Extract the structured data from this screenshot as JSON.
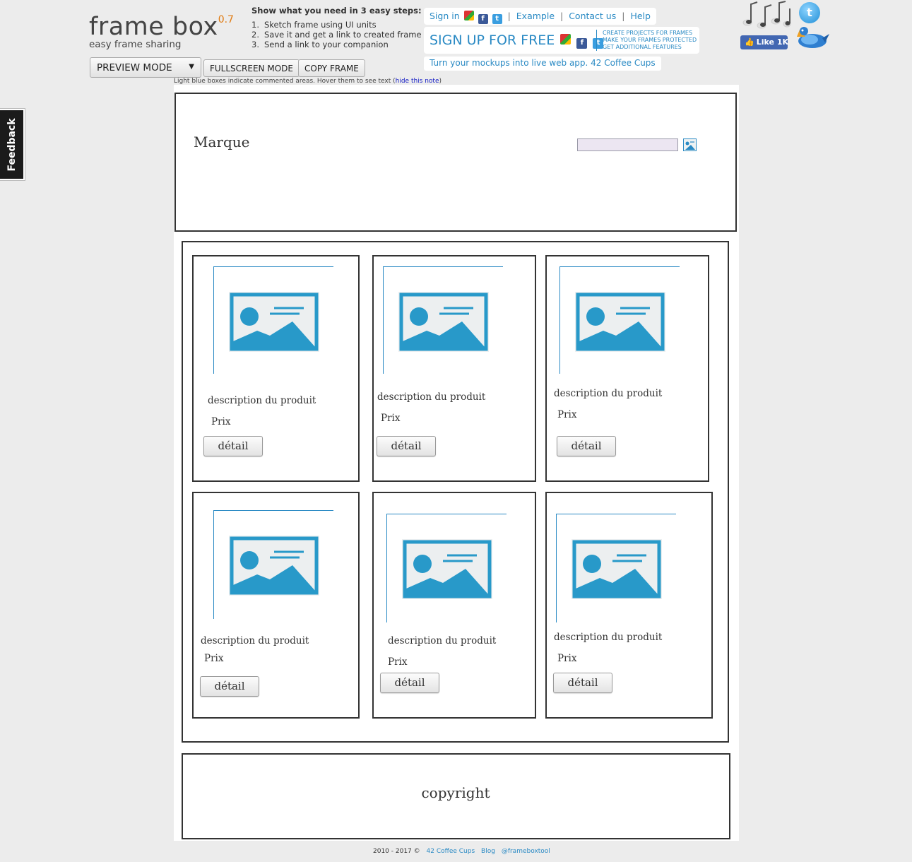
{
  "app": {
    "name": "frame box",
    "version": "0.7",
    "tagline": "easy frame sharing"
  },
  "steps": {
    "title": "Show what you need in 3 easy steps:",
    "items": [
      {
        "num": "1.",
        "text": "Sketch frame using UI units"
      },
      {
        "num": "2.",
        "text": "Save it and get a link to created frame"
      },
      {
        "num": "3.",
        "text": "Send a link to your companion"
      }
    ]
  },
  "toolbar": {
    "mode_select": "PREVIEW MODE",
    "fullscreen": "FULLSCREEN MODE",
    "copy": "COPY FRAME"
  },
  "note": {
    "text": "Light blue boxes indicate commented areas. Hover them to see text (",
    "link": "hide this note",
    "end": ")"
  },
  "account": {
    "sign_in": "Sign in",
    "example": "Example",
    "contact": "Contact us",
    "help": "Help",
    "sep": "|",
    "signup": "SIGN UP FOR FREE",
    "features": [
      "CREATE PROJECTS FOR FRAMES",
      "MAKE YOUR FRAMES PROTECTED",
      "GET ADDITIONAL FEATURES"
    ],
    "promo": "Turn your mockups into live web app. 42 Coffee Cups"
  },
  "social": {
    "like_label": "Like",
    "like_count": "1K",
    "twitter_glyph": "t",
    "facebook_glyph": "f"
  },
  "feedback": "Feedback",
  "mockup": {
    "brand": "Marque",
    "products": [
      {
        "description": "description du produit",
        "price": "Prix",
        "button": "détail"
      },
      {
        "description": "description du produit",
        "price": "Prix",
        "button": "détail"
      },
      {
        "description": "description du produit",
        "price": "Prix",
        "button": "détail"
      },
      {
        "description": "description du produit",
        "price": "Prix",
        "button": "détail"
      },
      {
        "description": "description du produit",
        "price": "Prix",
        "button": "détail"
      },
      {
        "description": "description du produit",
        "price": "Prix",
        "button": "détail"
      }
    ],
    "copyright": "copyright"
  },
  "footer": {
    "years": "2010 - 2017 ©",
    "link1": "42 Coffee Cups",
    "link2": "Blog",
    "link3": "@frameboxtool"
  },
  "colors": {
    "accent": "#2a8ac4",
    "image_placeholder": "#2899c9",
    "page_bg": "#ececec"
  }
}
